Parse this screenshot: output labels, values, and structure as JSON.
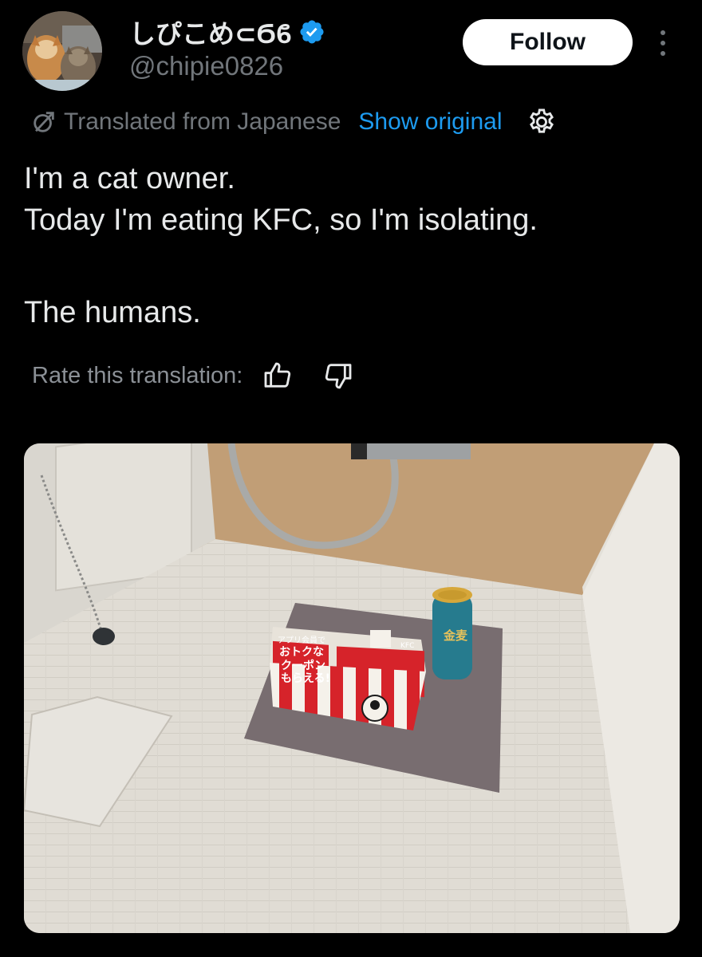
{
  "author": {
    "display_name": "しぴこめ⊂Ϭϐ",
    "handle": "@chipie0826",
    "verified": true,
    "avatar_icon": "cat-avatar"
  },
  "actions": {
    "follow_label": "Follow",
    "more_icon": "more-vertical-icon"
  },
  "translation": {
    "translated_label": "Translated from Japanese",
    "show_original_label": "Show original",
    "rate_label": "Rate this translation:"
  },
  "tweet": {
    "lines": [
      "I'm a cat owner.",
      "Today I'm eating KFC, so I'm isolating.",
      "The humans."
    ]
  },
  "media": {
    "box_text_1": "アプリ会員で",
    "box_text_2": "おトクな",
    "box_text_3": "クーポン",
    "box_text_4": "もらえる!",
    "box_brand": "KFC",
    "can_text": "金麦"
  },
  "colors": {
    "background": "#000000",
    "text_primary": "#e7e9ea",
    "text_secondary": "#71767b",
    "link": "#1d9bf0",
    "verified": "#1d9bf0"
  }
}
